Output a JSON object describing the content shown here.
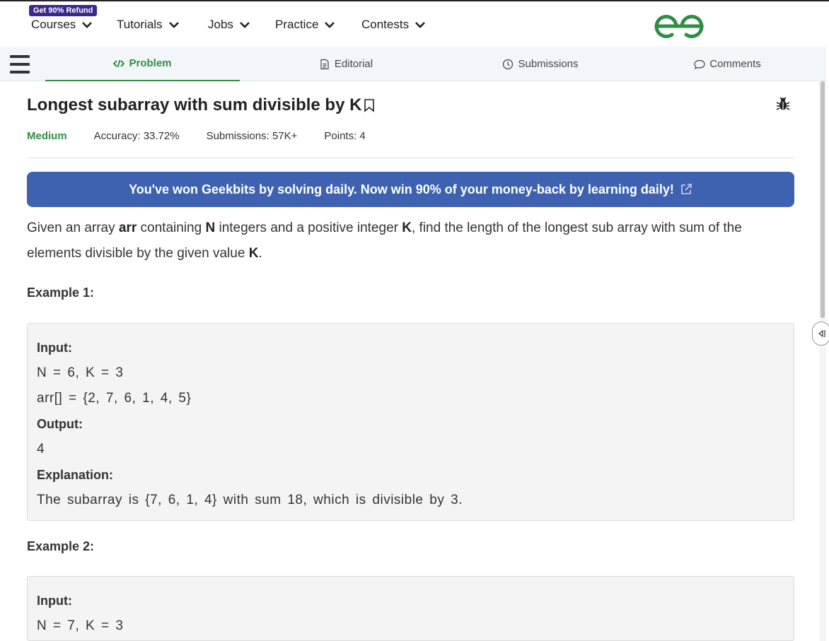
{
  "topnav": {
    "badge": "Get 90% Refund",
    "items": [
      {
        "label": "Courses"
      },
      {
        "label": "Tutorials"
      },
      {
        "label": "Jobs"
      },
      {
        "label": "Practice"
      },
      {
        "label": "Contests"
      }
    ],
    "logo_icon": "gfg-logo-icon"
  },
  "tabs": [
    {
      "label": "Problem",
      "icon": "code-icon",
      "active": true
    },
    {
      "label": "Editorial",
      "icon": "document-icon",
      "active": false
    },
    {
      "label": "Submissions",
      "icon": "clock-icon",
      "active": false
    },
    {
      "label": "Comments",
      "icon": "chat-bubble-icon",
      "active": false
    }
  ],
  "problem": {
    "title": "Longest subarray with sum divisible by K",
    "difficulty": "Medium",
    "accuracy": "Accuracy: 33.72%",
    "submissions": "Submissions: 57K+",
    "points": "Points: 4",
    "banner": "You've won Geekbits by solving daily. Now win 90% of your money-back by learning daily!",
    "description": {
      "p1": "Given an array ",
      "b1": "arr",
      "p2": " containing ",
      "b2": "N",
      "p3": " integers and a positive integer ",
      "b3": "K",
      "p4": ", find the length of the longest sub array with sum of the elements divisible by the given value ",
      "b4": "K",
      "p5": "."
    },
    "examples": [
      {
        "heading": "Example 1:",
        "input_label": "Input:",
        "input_line1": "N = 6, K = 3",
        "input_line2": "arr[] = {2, 7, 6, 1, 4, 5}",
        "output_label": "Output:",
        "output": "4",
        "explanation_label": "Explanation:",
        "explanation": "The subarray is {7, 6, 1, 4} with sum 18, which is divisible by 3."
      },
      {
        "heading": "Example 2:",
        "input_label": "Input:",
        "input_line1": "N = 7, K = 3"
      }
    ]
  },
  "colors": {
    "accent_green": "#2f8d46",
    "banner_blue": "#3f62b0",
    "badge_purple": "#3b2a8c"
  }
}
